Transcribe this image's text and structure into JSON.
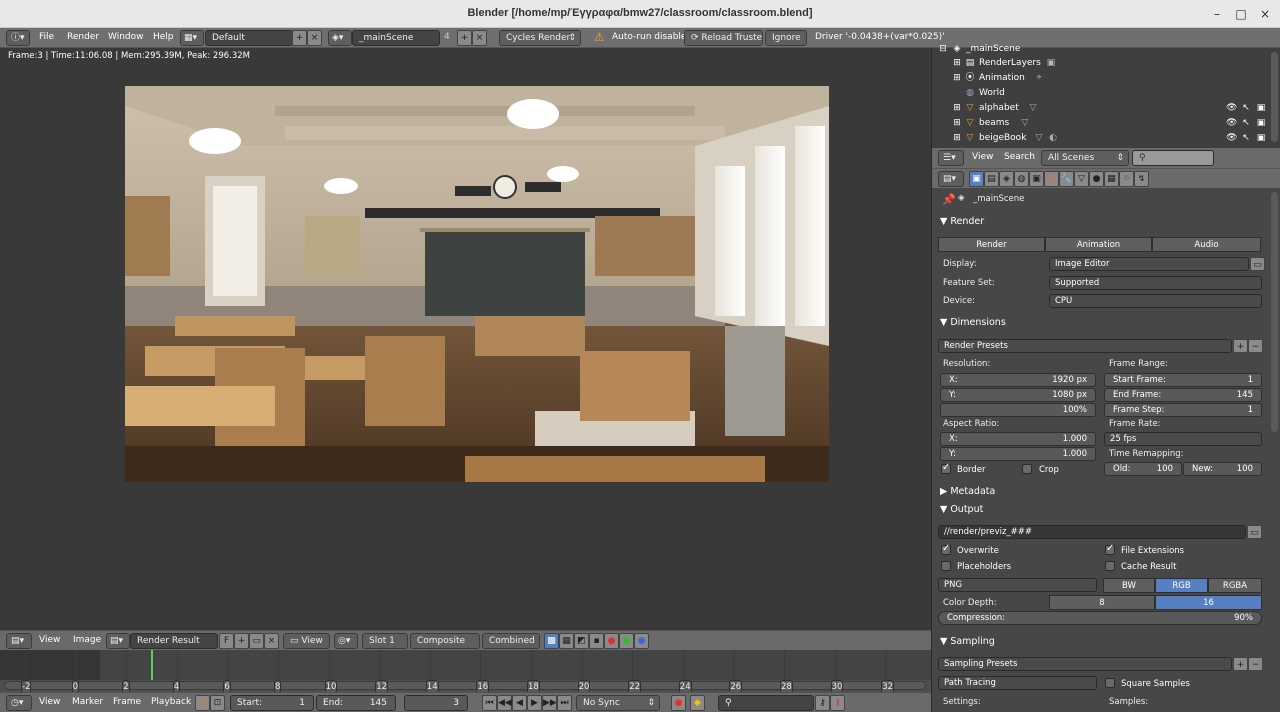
{
  "window": {
    "title": "Blender [/home/mp/Έγγραφα/bmw27/classroom/classroom.blend]",
    "minimize": "–",
    "maximize": "□",
    "close": "×"
  },
  "info_header": {
    "menus": [
      "File",
      "Render",
      "Window",
      "Help"
    ],
    "layout": "Default",
    "scene": "_mainScene",
    "scene_users": "4",
    "engine": "Cycles Render",
    "autorun_warning": "Auto-run disabled",
    "reload_trusted": "Reload Trusted",
    "ignore": "Ignore",
    "driver": "Driver '-0.0438+(var*0.025)'"
  },
  "image_editor": {
    "stats": "Frame:3 | Time:11:06.08 | Mem:295.39M, Peak: 296.32M",
    "header": {
      "view": "View",
      "image": "Image",
      "image_name": "Render Result",
      "fake_user": "F",
      "view_dd": "View",
      "slot": "Slot 1",
      "layer": "Composite",
      "pass": "Combined"
    }
  },
  "timeline": {
    "ticks": [
      "-2",
      "0",
      "2",
      "4",
      "6",
      "8",
      "10",
      "12",
      "14",
      "16",
      "18",
      "20",
      "22",
      "24",
      "26",
      "28",
      "30",
      "32"
    ],
    "current_frame_value": 3,
    "header": {
      "view": "View",
      "marker": "Marker",
      "frame": "Frame",
      "playback": "Playback",
      "start_label": "Start:",
      "start": "1",
      "end_label": "End:",
      "end": "145",
      "current": "3",
      "sync": "No Sync"
    }
  },
  "outliner": {
    "items": [
      {
        "label": "_mainScene"
      },
      {
        "label": "RenderLayers"
      },
      {
        "label": "Animation"
      },
      {
        "label": "World"
      },
      {
        "label": "alphabet"
      },
      {
        "label": "beams"
      },
      {
        "label": "beigeBook"
      }
    ],
    "header": {
      "view": "View",
      "search": "Search",
      "filter": "All Scenes"
    }
  },
  "properties": {
    "scene_path": "_mainScene",
    "render": {
      "title": "Render",
      "render_btn": "Render",
      "animation_btn": "Animation",
      "audio_btn": "Audio",
      "display_label": "Display:",
      "display": "Image Editor",
      "feature_label": "Feature Set:",
      "feature": "Supported",
      "device_label": "Device:",
      "device": "CPU"
    },
    "dimensions": {
      "title": "Dimensions",
      "presets": "Render Presets",
      "resolution_label": "Resolution:",
      "x_label": "X:",
      "x": "1920 px",
      "y_label": "Y:",
      "y": "1080 px",
      "percent": "100%",
      "frame_range_label": "Frame Range:",
      "start_label": "Start Frame:",
      "start": "1",
      "end_label": "End Frame:",
      "end": "145",
      "step_label": "Frame Step:",
      "step": "1",
      "aspect_label": "Aspect Ratio:",
      "ax": "1.000",
      "ay": "1.000",
      "frame_rate_label": "Frame Rate:",
      "frame_rate": "25 fps",
      "remap_label": "Time Remapping:",
      "old_label": "Old:",
      "old": "100",
      "new_label": "New:",
      "new": "100",
      "border": "Border",
      "crop": "Crop"
    },
    "metadata": {
      "title": "Metadata"
    },
    "output": {
      "title": "Output",
      "path": "//render/previz_###",
      "overwrite": "Overwrite",
      "file_ext": "File Extensions",
      "placeholders": "Placeholders",
      "cache_result": "Cache Result",
      "format": "PNG",
      "bw": "BW",
      "rgb": "RGB",
      "rgba": "RGBA",
      "depth_label": "Color Depth:",
      "depth8": "8",
      "depth16": "16",
      "compression_label": "Compression:",
      "compression": "90%"
    },
    "sampling": {
      "title": "Sampling",
      "presets": "Sampling Presets",
      "integrator": "Path Tracing",
      "square": "Square Samples",
      "settings_label": "Settings:",
      "samples_label": "Samples:"
    }
  }
}
